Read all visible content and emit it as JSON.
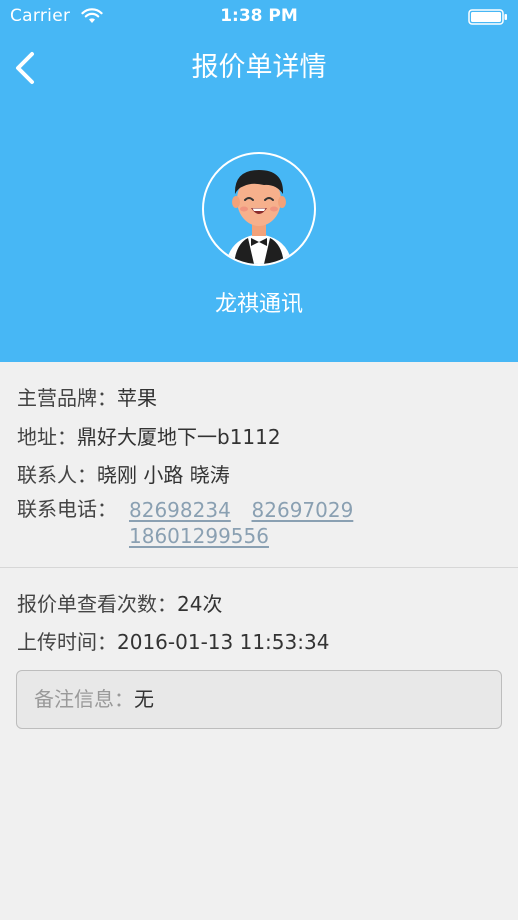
{
  "status_bar": {
    "carrier": "Carrier",
    "time": "1:38 PM"
  },
  "nav": {
    "title": "报价单详情"
  },
  "store": {
    "name": "龙祺通讯"
  },
  "details": {
    "brand_label": "主营品牌：",
    "brand_value": "苹果",
    "address_label": "地址：",
    "address_value": "鼎好大厦地下一b1112",
    "contacts_label": "联系人：",
    "contacts_value": "晓刚 小路 晓涛",
    "phone_label": "联系电话：",
    "phones": [
      "82698234",
      "82697029",
      "18601299556"
    ]
  },
  "stats": {
    "views_label": "报价单查看次数：",
    "views_value": "24次",
    "upload_label": "上传时间：",
    "upload_value": "2016-01-13 11:53:34"
  },
  "remark": {
    "label": "备注信息：",
    "value": "无"
  },
  "colors": {
    "header_bg": "#47b7f5",
    "page_bg": "#f0f0f0",
    "link": "#8aa0b2"
  },
  "icons": {
    "back": "chevron-left-icon",
    "wifi": "wifi-icon",
    "battery": "battery-icon",
    "avatar": "avatar-waiter"
  }
}
